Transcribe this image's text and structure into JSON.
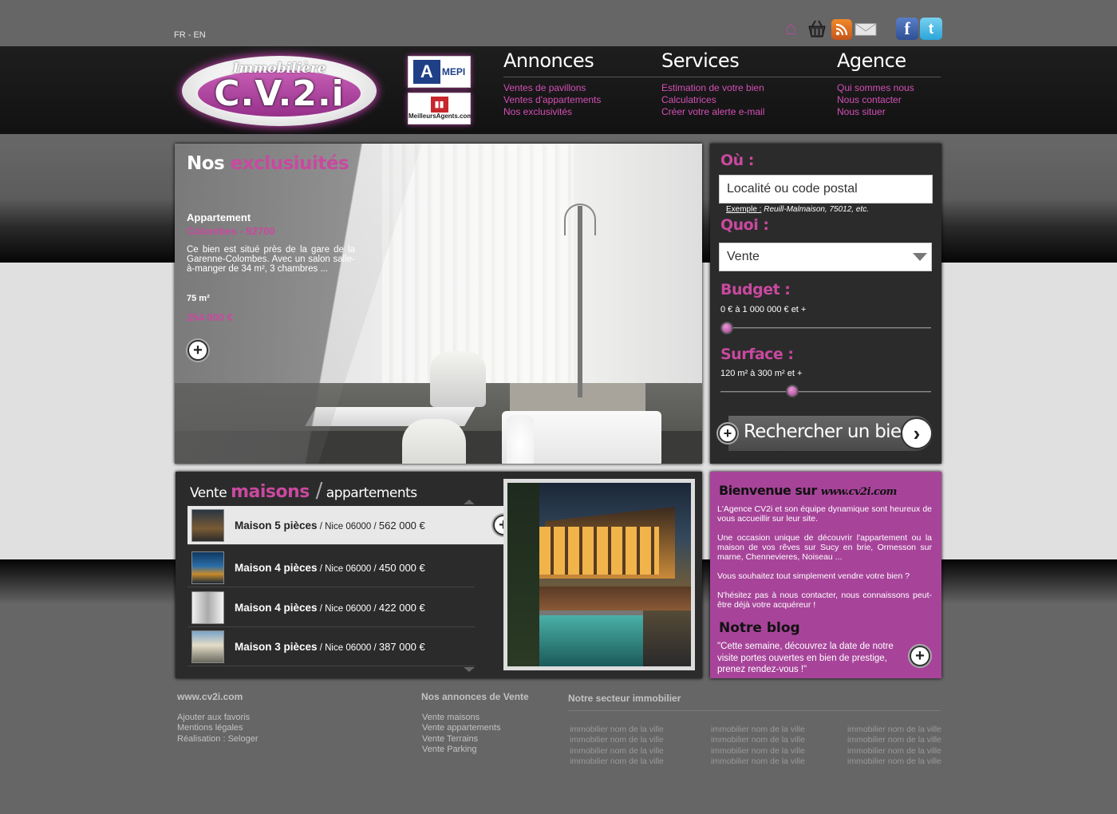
{
  "lang": {
    "fr": "FR",
    "sep": " - ",
    "en": "EN"
  },
  "top_icons": [
    "home-icon",
    "basket-icon",
    "rss-icon",
    "mail-icon",
    "facebook-icon",
    "twitter-icon"
  ],
  "logo": {
    "top": "Immobilière",
    "main": "C.V.2.i"
  },
  "partners": {
    "amepi": "MEPI",
    "meilleurs_agents": "MeilleursAgents.com"
  },
  "menu": {
    "annonces": {
      "title": "Annonces",
      "links": [
        "Ventes de pavillons",
        "Ventes d'appartements",
        "Nos exclusivités"
      ]
    },
    "services": {
      "title": "Services",
      "links": [
        "Estimation de votre bien",
        "Calculatrices",
        "Créer votre alerte e-mail"
      ]
    },
    "agence": {
      "title": "Agence",
      "links": [
        "Qui sommes nous",
        "Nous contacter",
        "Nous situer"
      ]
    }
  },
  "hero": {
    "title_white": "Nos ",
    "title_pink": "exclusiuités",
    "type": "Appartement",
    "city": "Colombes - 92700",
    "desc": "Ce bien est situé près de la gare de la Garenne-Colombes. Avec un salon salle-à-manger de 34 m², 3 chambres ...",
    "area": "75 m²",
    "price": "254 000 €"
  },
  "search": {
    "ou_label": "Où :",
    "location_placeholder": "Localité ou code postal",
    "example_label": "Exemple :",
    "example_text": " Reuill-Malmaison, 75012, etc.",
    "quoi_label": "Quoi :",
    "quoi_value": "Vente",
    "budget_label": "Budget :",
    "budget_value": "0 € à 1 000 000 € et +",
    "budget_position": 0.0,
    "surface_label": "Surface :",
    "surface_value": "120 m² à 300 m² et +",
    "surface_position": 0.33,
    "button_label": "Rechercher un bien"
  },
  "listing": {
    "title_vente": "Vente ",
    "title_maisons": "maisons",
    "title_sep": " /",
    "title_appart": " appartements",
    "rows": [
      {
        "name": "Maison 5 pièces",
        "loc": " / Nice 06000 / ",
        "price": "562 000 €"
      },
      {
        "name": "Maison 4 pièces",
        "loc": " / Nice 06000 / ",
        "price": "450 000 €"
      },
      {
        "name": "Maison 4 pièces",
        "loc": " / Nice 06000 / ",
        "price": "422 000 €"
      },
      {
        "name": "Maison 3 pièces",
        "loc": " / Nice 06000 / ",
        "price": "387 000 €"
      }
    ]
  },
  "welcome": {
    "title": "Bienvenue sur ",
    "site": "www.cv2i.com",
    "p1": "L'Agence CV2i et son équipe dynamique sont heureux de vous accueillir sur leur site.",
    "p2": "Une occasion unique de découvrir l'appartement ou la maison de vos rêves sur Sucy en brie, Ormesson sur marne, Chennevieres, Noiseau ...",
    "p3": "Vous souhaitez tout simplement vendre votre bien ?",
    "p4": "N'hésitez pas à nous contacter, nous connaissons peut-être déjà votre acquéreur !",
    "blog_title": "Notre blog",
    "blog_quote": "\"Cette semaine, découvrez la date de notre visite portes ouvertes en bien de prestige, prenez rendez-vous !\""
  },
  "footer": {
    "col1_title": "www.cv2i.com",
    "col1_links": [
      "Ajouter aux favoris",
      "Mentions légales",
      "Réalisation : Seloger"
    ],
    "col2_title": "Nos annonces de Vente",
    "col2_links": [
      "Vente maisons",
      "Vente appartements",
      "Vente Terrains",
      "Vente Parking"
    ],
    "col3_title": "Notre secteur immobilier",
    "col3_links": [
      "immobilier nom de la ville",
      "immobilier nom de la ville",
      "immobilier nom de la ville",
      "immobilier nom de la ville"
    ]
  },
  "colors": {
    "accent": "#c9499f",
    "panel": "#2b2b2b",
    "welcome_bg": "#a7449a"
  }
}
